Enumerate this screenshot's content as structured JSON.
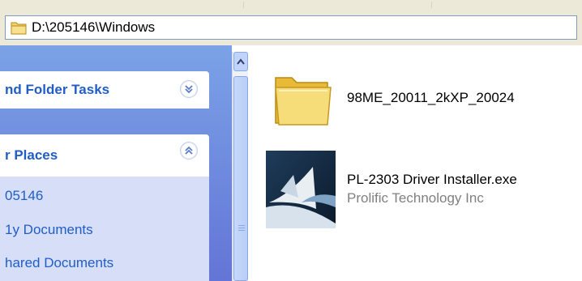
{
  "address_bar": {
    "path": "D:\\205146\\Windows",
    "icon": "folder-icon"
  },
  "task_pane": {
    "file_and_folder_tasks": {
      "title": "nd Folder Tasks",
      "toggle_icon": "chevron-double-down-icon"
    },
    "other_places": {
      "title": "r Places",
      "toggle_icon": "chevron-double-up-icon",
      "links": [
        "05146",
        "1y Documents",
        "hared Documents"
      ]
    }
  },
  "scrollbar": {
    "up_icon": "scroll-up-arrow-icon"
  },
  "files": [
    {
      "name": "98ME_20011_2kXP_20024",
      "icon": "folder-icon"
    },
    {
      "name": "PL-2303 Driver Installer.exe",
      "company": "Prolific Technology Inc",
      "icon": "installer-icon"
    }
  ],
  "colors": {
    "link_blue": "#215dc6",
    "pane_gradient_top": "#7ba2e7",
    "pane_gradient_bottom": "#6375d6",
    "toolbar_bg": "#ece9d8"
  }
}
